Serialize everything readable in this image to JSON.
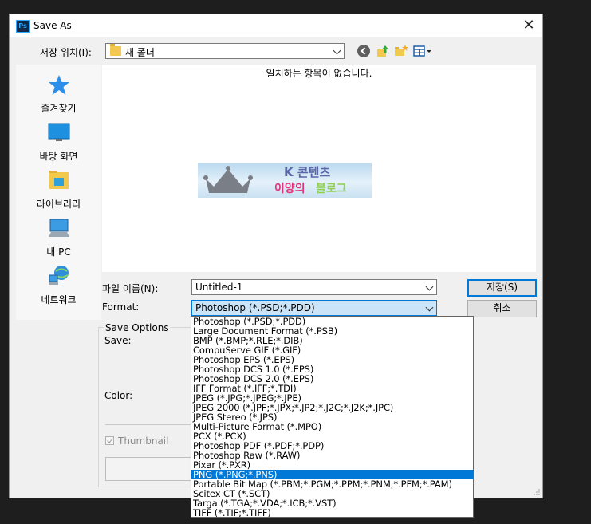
{
  "window": {
    "title": "Save As"
  },
  "toolbar": {
    "location_label": "저장 위치(I):",
    "location_value": "새 폴더"
  },
  "places": [
    {
      "label": "즐겨찾기",
      "icon": "star-icon"
    },
    {
      "label": "바탕 화면",
      "icon": "desktop-icon"
    },
    {
      "label": "라이브러리",
      "icon": "library-icon"
    },
    {
      "label": "내 PC",
      "icon": "pc-icon"
    },
    {
      "label": "네트워크",
      "icon": "network-icon"
    }
  ],
  "listview": {
    "empty_message": "일치하는 항목이 없습니다.",
    "watermark": {
      "line1": "K 콘텐츠",
      "line2a": "이양의",
      "line2b": "블로그"
    }
  },
  "form": {
    "filename_label": "파일 이름(N):",
    "filename_value": "Untitled-1",
    "format_label": "Format:",
    "format_value": "Photoshop (*.PSD;*.PDD)"
  },
  "buttons": {
    "save": "저장(S)",
    "cancel": "취소"
  },
  "options": {
    "legend": "Save Options",
    "save_label": "Save:",
    "color_label": "Color:",
    "thumbnail_label": "Thumbnail"
  },
  "format_options": [
    "Photoshop (*.PSD;*.PDD)",
    "Large Document Format (*.PSB)",
    "BMP (*.BMP;*.RLE;*.DIB)",
    "CompuServe GIF (*.GIF)",
    "Photoshop EPS (*.EPS)",
    "Photoshop DCS 1.0 (*.EPS)",
    "Photoshop DCS 2.0 (*.EPS)",
    "IFF Format (*.IFF;*.TDI)",
    "JPEG (*.JPG;*.JPEG;*.JPE)",
    "JPEG 2000 (*.JPF;*.JPX;*.JP2;*.J2C;*.J2K;*.JPC)",
    "JPEG Stereo (*.JPS)",
    "Multi-Picture Format (*.MPO)",
    "PCX (*.PCX)",
    "Photoshop PDF (*.PDF;*.PDP)",
    "Photoshop Raw (*.RAW)",
    "Pixar (*.PXR)",
    "PNG (*.PNG;*.PNS)",
    "Portable Bit Map (*.PBM;*.PGM;*.PPM;*.PNM;*.PFM;*.PAM)",
    "Scitex CT (*.SCT)",
    "Targa (*.TGA;*.VDA;*.ICB;*.VST)",
    "TIFF (*.TIF;*.TIFF)"
  ],
  "selected_format": "PNG (*.PNG;*.PNS)",
  "colors": {
    "accent": "#0078d7",
    "dialog_bg": "#f0f0f0",
    "backdrop": "#1e1e1e"
  }
}
